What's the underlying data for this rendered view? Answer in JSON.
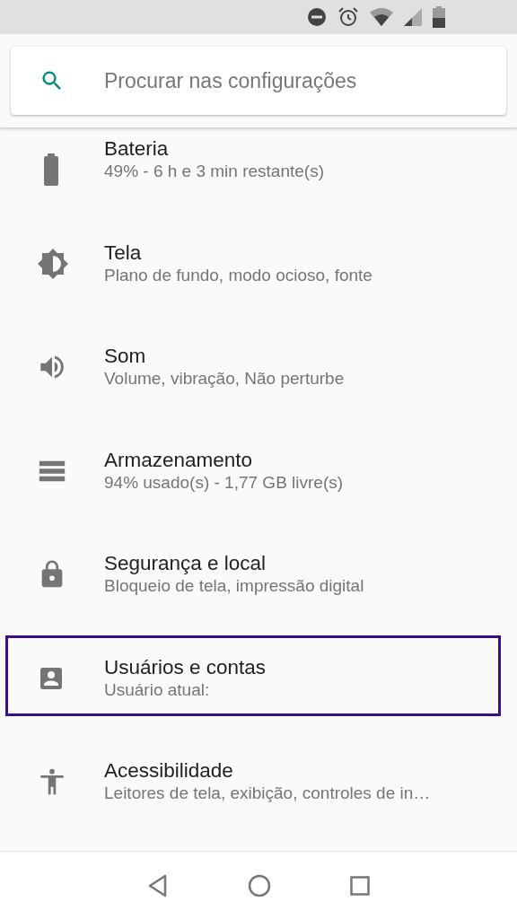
{
  "search": {
    "placeholder": "Procurar nas configurações"
  },
  "items": [
    {
      "title": "Bateria",
      "subtitle": "49% - 6 h e 3 min restante(s)",
      "selected": false
    },
    {
      "title": "Tela",
      "subtitle": "Plano de fundo, modo ocioso, fonte",
      "selected": false
    },
    {
      "title": "Som",
      "subtitle": "Volume, vibração, Não perturbe",
      "selected": false
    },
    {
      "title": "Armazenamento",
      "subtitle": "94% usado(s) - 1,77 GB livre(s)",
      "selected": false
    },
    {
      "title": "Segurança e local",
      "subtitle": "Bloqueio de tela, impressão digital",
      "selected": false
    },
    {
      "title": "Usuários e contas",
      "subtitle": "Usuário atual:",
      "selected": true
    },
    {
      "title": "Acessibilidade",
      "subtitle": "Leitores de tela, exibição, controles de in…",
      "selected": false
    }
  ]
}
